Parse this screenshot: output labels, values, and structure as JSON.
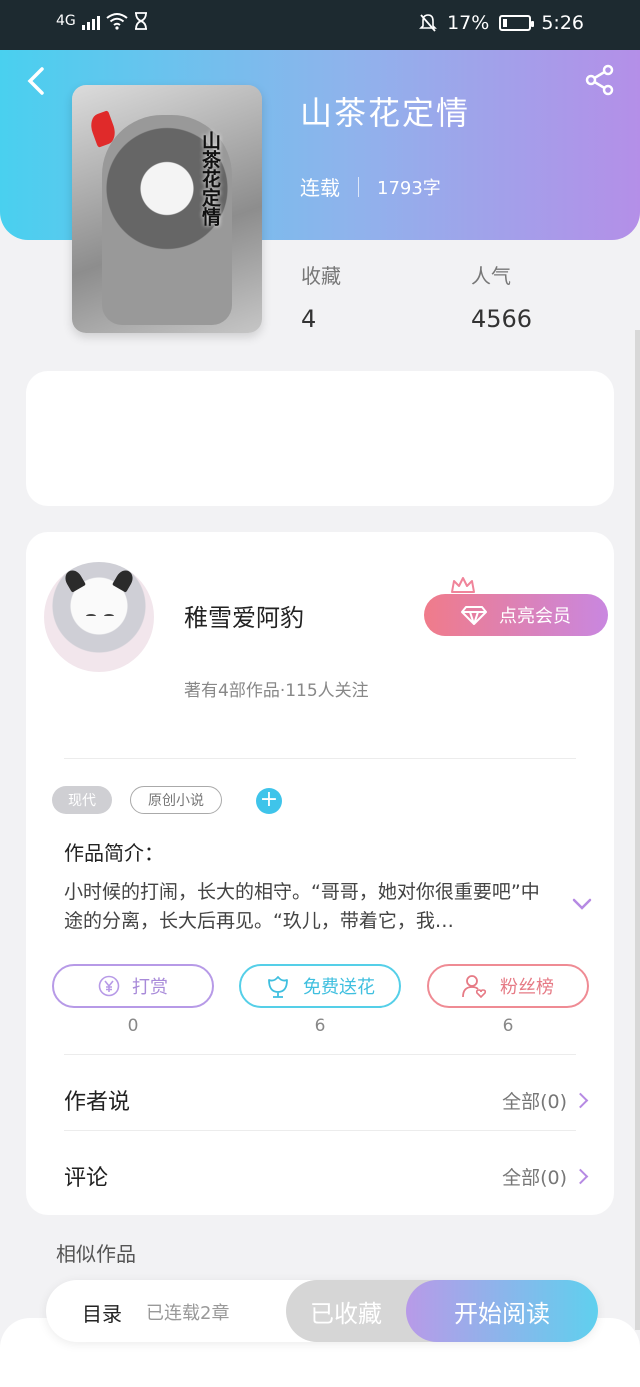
{
  "status_bar": {
    "network": "4G",
    "battery_percent": "17%",
    "time": "5:26",
    "battery_level": 0.17
  },
  "book": {
    "title": "山茶花定情",
    "status": "连载",
    "word_count": "1793字",
    "cover_title": "山茶花定情",
    "stats": [
      {
        "label": "收藏",
        "value": "4"
      },
      {
        "label": "人气",
        "value": "4566"
      }
    ]
  },
  "author": {
    "name": "稚雪爱阿豹",
    "summary": "著有4部作品·115人关注",
    "vip_button": "点亮会员"
  },
  "tags": [
    "现代",
    "原创小说"
  ],
  "intro": {
    "label": "作品简介：",
    "text": "小时候的打闹，长大的相守。“哥哥，她对你很重要吧”中途的分离，长大后再见。“玖儿，带着它，我…"
  },
  "actions": [
    {
      "label": "打赏",
      "count": "0",
      "icon": "yen-icon"
    },
    {
      "label": "免费送花",
      "count": "6",
      "icon": "flower-icon"
    },
    {
      "label": "粉丝榜",
      "count": "6",
      "icon": "fan-rank-icon"
    }
  ],
  "rows": [
    {
      "label": "作者说",
      "right": "全部(0)"
    },
    {
      "label": "评论",
      "right": "全部(0)"
    }
  ],
  "similar_title": "相似作品",
  "bottom_bar": {
    "toc": "目录",
    "chapters": "已连载2章",
    "collected": "已收藏",
    "read": "开始阅读"
  }
}
